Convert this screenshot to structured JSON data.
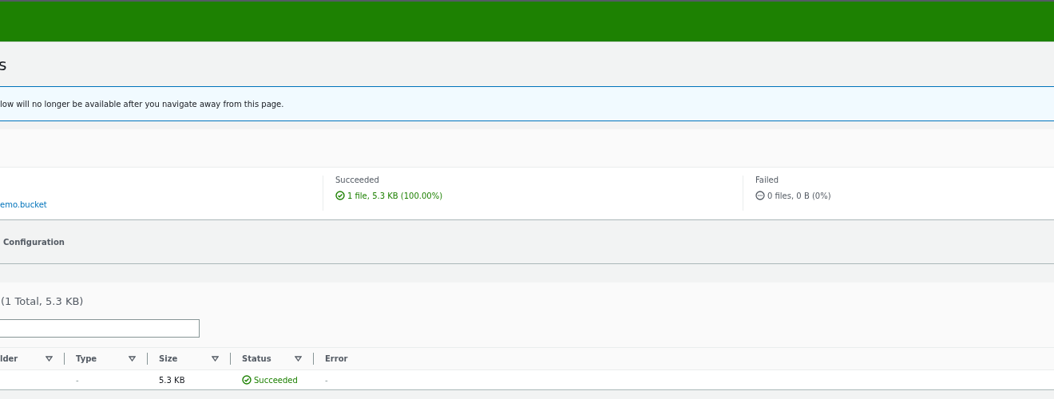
{
  "header": {
    "title": "s"
  },
  "alert": {
    "text": "low will no longer be available after you navigate away from this page."
  },
  "summary": {
    "destination": "emo.bucket",
    "stats": [
      {
        "label": "Succeeded",
        "value": "1 file, 5.3 KB (100.00%)",
        "kind": "success"
      },
      {
        "label": "Failed",
        "value": "0 files, 0 B (0%)",
        "kind": "neutral"
      }
    ]
  },
  "tabs": [
    {
      "label": "Configuration",
      "selected": false
    }
  ],
  "files": {
    "heading": "(1 Total, 5.3 KB)",
    "columns": [
      {
        "label": "lder",
        "sortable": true
      },
      {
        "label": "Type",
        "sortable": true
      },
      {
        "label": "Size",
        "sortable": true
      },
      {
        "label": "Status",
        "sortable": true
      },
      {
        "label": "Error",
        "sortable": false
      }
    ],
    "rows": [
      {
        "type": "-",
        "size": "5.3 KB",
        "status": {
          "label": "Succeeded",
          "kind": "success"
        },
        "error": "-"
      }
    ]
  }
}
